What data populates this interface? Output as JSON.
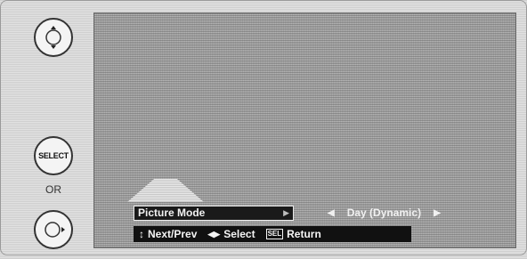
{
  "remote_buttons": {
    "select_label": "SELECT",
    "or_label": "OR"
  },
  "menu": {
    "picture_mode_label": "Picture Mode",
    "picture_mode_value": "Day (Dynamic)"
  },
  "help_bar": {
    "next_prev_label": "Next/Prev",
    "select_label": "Select",
    "sel_key_label": "SEL",
    "return_label": "Return"
  },
  "icons": [
    "nav-up-down-icon",
    "nav-right-icon",
    "left-arrow-icon",
    "right-arrow-icon",
    "up-down-arrow-icon",
    "left-right-arrow-icon"
  ]
}
